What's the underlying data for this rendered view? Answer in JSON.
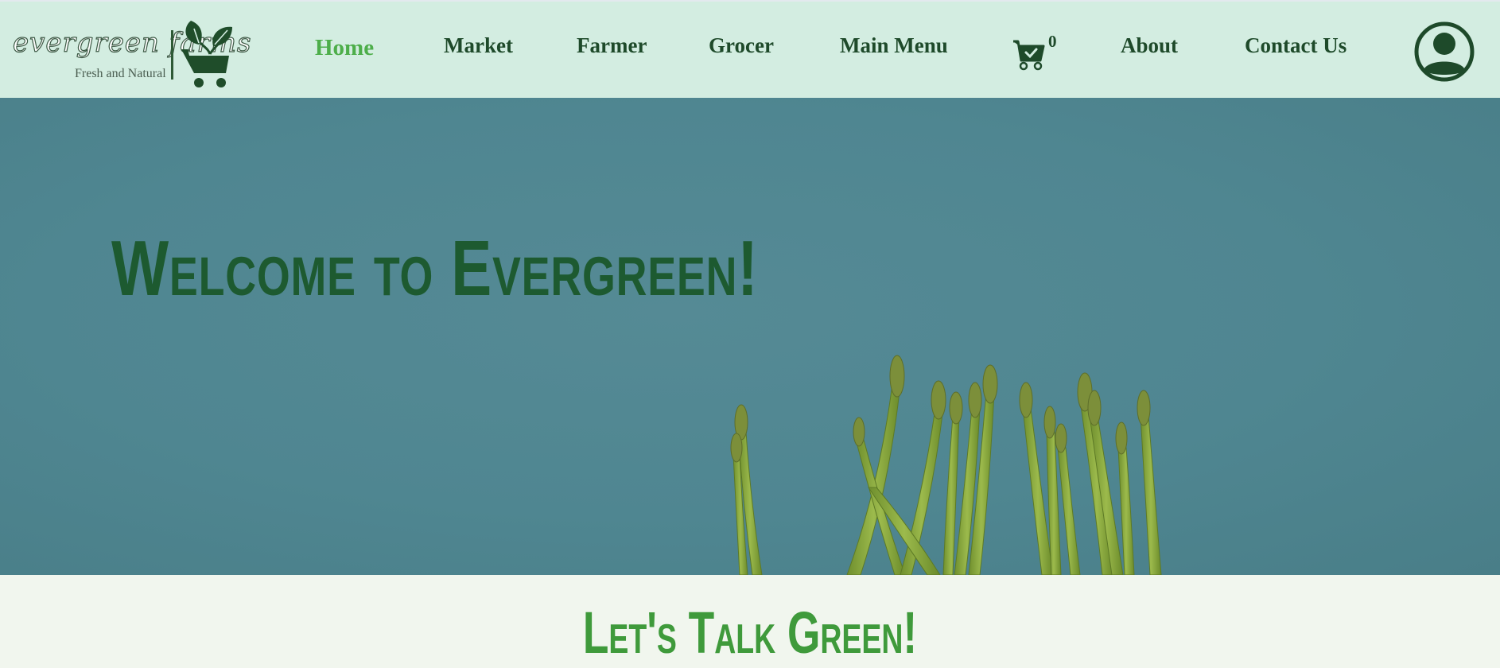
{
  "logo": {
    "brand": "evergreen farms",
    "tagline": "Fresh and Natural",
    "icon": "plant-cart-icon"
  },
  "nav": {
    "items": [
      {
        "label": "Home",
        "active": true
      },
      {
        "label": "Market",
        "active": false
      },
      {
        "label": "Farmer",
        "active": false
      },
      {
        "label": "Grocer",
        "active": false
      },
      {
        "label": "Main Menu",
        "active": false
      },
      {
        "label": "About",
        "active": false
      },
      {
        "label": "Contact Us",
        "active": false
      }
    ],
    "cart": {
      "icon": "cart-check-icon",
      "count": "0"
    },
    "account": {
      "icon": "user-account-icon"
    }
  },
  "hero": {
    "title": "Welcome to Evergreen!",
    "image": "asparagus-bunch"
  },
  "section": {
    "title": "Let's Talk Green!"
  },
  "colors": {
    "nav_background": "#d3ede1",
    "nav_text": "#1e4a2a",
    "nav_active": "#4dae4a",
    "hero_background": "#4f8691",
    "hero_title": "#1d5a30",
    "section_background": "#f1f6ee",
    "section_title": "#3f9a3b"
  }
}
